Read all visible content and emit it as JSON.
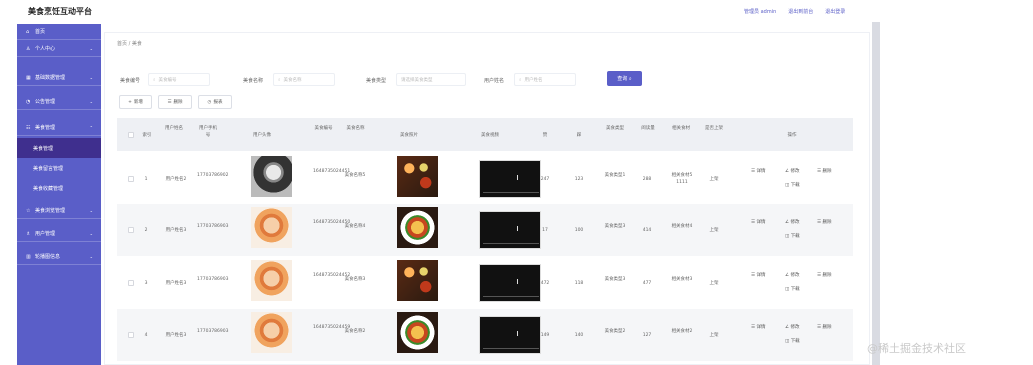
{
  "header": {
    "title": "美食烹饪互动平台",
    "links": [
      "管理员 admin",
      "退出到前台",
      "退出登录"
    ]
  },
  "sidebar": {
    "items": [
      {
        "icon": "home-icon",
        "glyph": "⌂",
        "label": "首页",
        "chevron": false
      },
      {
        "icon": "user-icon",
        "glyph": "♙",
        "label": "个人中心",
        "chevron": true
      },
      {
        "icon": "grid-icon",
        "glyph": "▦",
        "label": "基础数据管理",
        "chevron": true
      },
      {
        "icon": "bell-icon",
        "glyph": "◔",
        "label": "公告管理",
        "chevron": true
      },
      {
        "icon": "food-icon",
        "glyph": "☷",
        "label": "美食管理",
        "chevron": true
      },
      {
        "icon": "star-icon",
        "glyph": "☆",
        "label": "美食浏览管理",
        "chevron": true
      },
      {
        "icon": "users-icon",
        "glyph": "♗",
        "label": "用户管理",
        "chevron": true
      },
      {
        "icon": "chart-icon",
        "glyph": "▥",
        "label": "轮播图信息",
        "chevron": true
      }
    ],
    "submenu": [
      "美食管理",
      "美食留言管理",
      "美食收藏管理"
    ]
  },
  "breadcrumb": "首页 / 美食",
  "filters": [
    {
      "label": "美食编号",
      "placeholder": "美食编号"
    },
    {
      "label": "美食名称",
      "placeholder": "美食名称"
    },
    {
      "label": "美食类型",
      "placeholder": "请选择美食类型"
    },
    {
      "label": "用户姓名",
      "placeholder": "用户姓名"
    }
  ],
  "search_button": "查询",
  "actions": [
    {
      "icon": "+",
      "label": "新增"
    },
    {
      "icon": "☰",
      "label": "删除"
    },
    {
      "icon": "◷",
      "label": "报表"
    }
  ],
  "table": {
    "columns": [
      "索引",
      "用户姓名",
      "用户手机号",
      "用户头像",
      "美食编号",
      "美食名称",
      "美食照片",
      "美食视频",
      "赞",
      "踩",
      "美食类型",
      "阅读量",
      "相关食材",
      "是否上架",
      "操作"
    ],
    "rows": [
      {
        "index": "1",
        "user": "用户姓名2",
        "phone": "17703786902",
        "avatar": "bw",
        "code": "1648735024451",
        "name": "美食名称5",
        "photo": "a",
        "likes": "247",
        "dislikes": "123",
        "type": "美食类型1",
        "views": "288",
        "ingredients": "相关食材5 1111",
        "status": "上架"
      },
      {
        "index": "2",
        "user": "用户姓名3",
        "phone": "17703786903",
        "avatar": "girl",
        "code": "1648735024450",
        "name": "美食名称4",
        "photo": "b",
        "likes": "17",
        "dislikes": "100",
        "type": "美食类型3",
        "views": "414",
        "ingredients": "相关食材4",
        "status": "上架"
      },
      {
        "index": "3",
        "user": "用户姓名3",
        "phone": "17703786903",
        "avatar": "girl",
        "code": "1648735024452",
        "name": "美食名称3",
        "photo": "a",
        "likes": "472",
        "dislikes": "118",
        "type": "美食类型3",
        "views": "477",
        "ingredients": "相关食材3",
        "status": "上架"
      },
      {
        "index": "4",
        "user": "用户姓名3",
        "phone": "17703786903",
        "avatar": "girl",
        "code": "1648735024459",
        "name": "美食名称2",
        "photo": "b",
        "likes": "149",
        "dislikes": "140",
        "type": "美食类型2",
        "views": "127",
        "ingredients": "相关食材2",
        "status": "上架"
      }
    ],
    "row_actions": [
      "详情",
      "修改",
      "删除",
      "下载"
    ]
  },
  "watermark": "@稀土掘金技术社区"
}
